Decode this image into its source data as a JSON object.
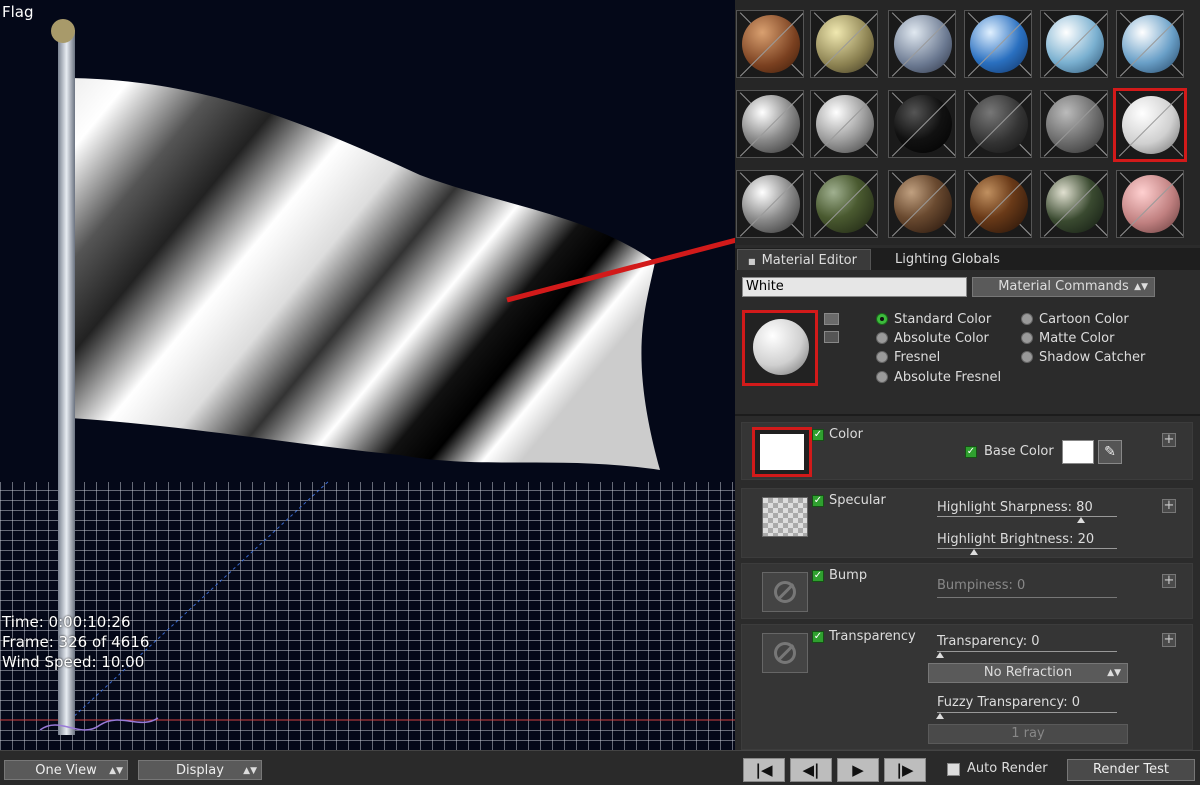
{
  "viewport": {
    "title": "Flag",
    "hud": [
      "Time: 0:00:10:26",
      "Frame: 326 of 4616",
      "Wind Speed: 10.00"
    ]
  },
  "bottom_bar": {
    "view_label": "One View",
    "display_label": "Display",
    "auto_render_label": "Auto Render",
    "render_test_label": "Render Test",
    "transport": [
      "|◀",
      "◀|",
      "▶",
      "|▶"
    ]
  },
  "tabs": [
    "Material Editor",
    "Lighting Globals"
  ],
  "material": {
    "name": "White",
    "commands_label": "Material Commands"
  },
  "radio_options": [
    {
      "label": "Standard Color",
      "selected": true
    },
    {
      "label": "Absolute Color",
      "selected": false
    },
    {
      "label": "Fresnel",
      "selected": false
    },
    {
      "label": "Absolute Fresnel",
      "selected": false
    },
    {
      "label": "Cartoon Color",
      "selected": false
    },
    {
      "label": "Matte Color",
      "selected": false
    },
    {
      "label": "Shadow Catcher",
      "selected": false
    }
  ],
  "sections": {
    "color": {
      "label": "Color",
      "base_color_label": "Base Color"
    },
    "specular": {
      "label": "Specular",
      "highlight_sharpness": "Highlight Sharpness: 80",
      "highlight_brightness": "Highlight Brightness: 20",
      "sharpness_value": 80,
      "brightness_value": 20
    },
    "bump": {
      "label": "Bump",
      "bumpiness": "Bumpiness: 0",
      "value": 0
    },
    "transparency": {
      "label": "Transparency",
      "transparency": "Transparency: 0",
      "refraction": "No Refraction",
      "fuzzy": "Fuzzy Transparency: 0",
      "rays": "1 ray",
      "value": 0,
      "fuzzy_value": 0
    }
  },
  "colors": {
    "accent_red": "#d21a1a",
    "check_green": "#2fa02f",
    "panel_bg": "#2b2b2b"
  }
}
